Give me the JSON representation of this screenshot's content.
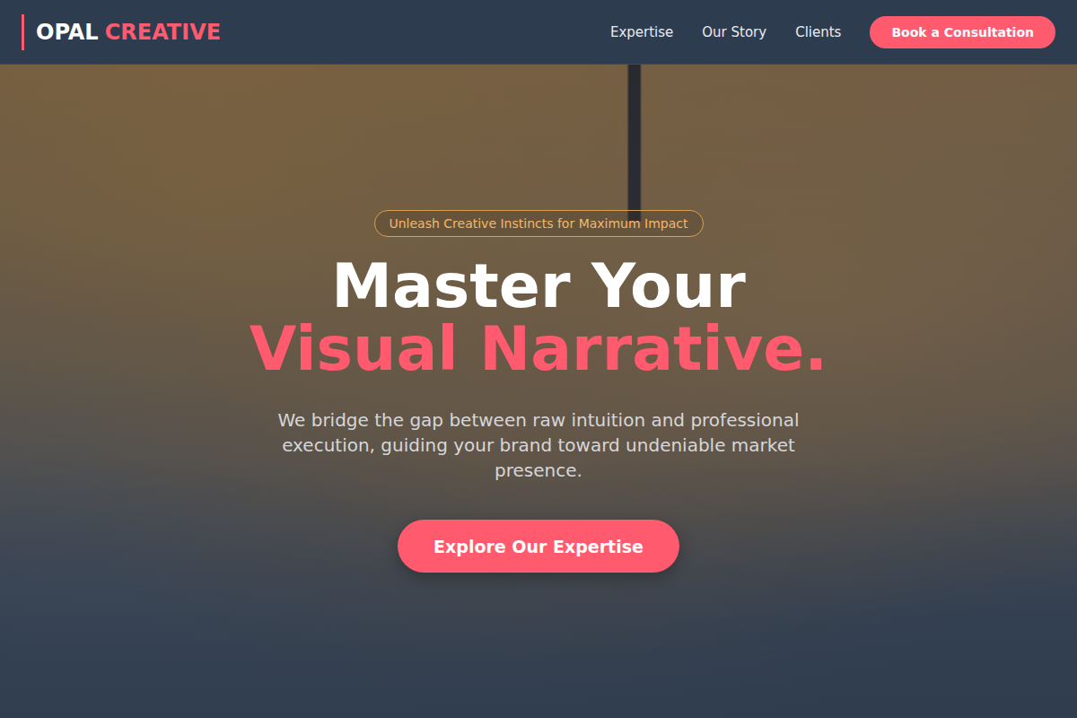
{
  "nav": {
    "logo": {
      "first": "OPAL",
      "second": "CREATIVE"
    },
    "links": [
      {
        "label": "Expertise"
      },
      {
        "label": "Our Story"
      },
      {
        "label": "Clients"
      }
    ],
    "cta": "Book a Consultation"
  },
  "hero": {
    "badge": "Unleash Creative Instincts for Maximum Impact",
    "title_line1": "Master Your",
    "title_line2": "Visual Narrative.",
    "subtitle": "We bridge the gap between raw intuition and professional execution, guiding your brand toward undeniable market presence.",
    "button": "Explore Our Expertise"
  }
}
